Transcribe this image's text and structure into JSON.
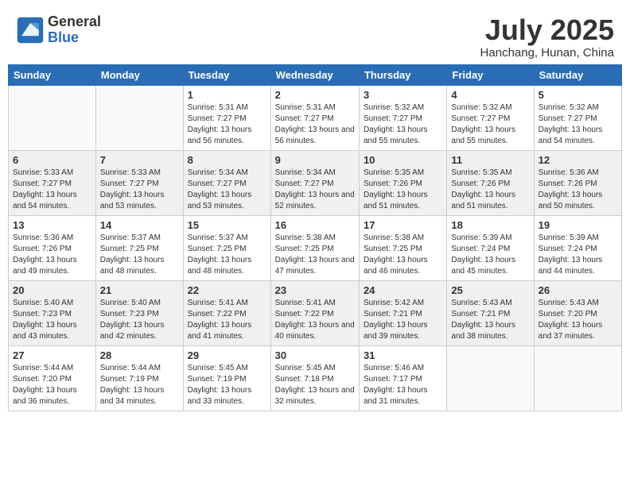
{
  "header": {
    "logo_general": "General",
    "logo_blue": "Blue",
    "month_title": "July 2025",
    "location": "Hanchang, Hunan, China"
  },
  "weekdays": [
    "Sunday",
    "Monday",
    "Tuesday",
    "Wednesday",
    "Thursday",
    "Friday",
    "Saturday"
  ],
  "weeks": [
    [
      {
        "day": "",
        "info": ""
      },
      {
        "day": "",
        "info": ""
      },
      {
        "day": "1",
        "info": "Sunrise: 5:31 AM\nSunset: 7:27 PM\nDaylight: 13 hours and 56 minutes."
      },
      {
        "day": "2",
        "info": "Sunrise: 5:31 AM\nSunset: 7:27 PM\nDaylight: 13 hours and 56 minutes."
      },
      {
        "day": "3",
        "info": "Sunrise: 5:32 AM\nSunset: 7:27 PM\nDaylight: 13 hours and 55 minutes."
      },
      {
        "day": "4",
        "info": "Sunrise: 5:32 AM\nSunset: 7:27 PM\nDaylight: 13 hours and 55 minutes."
      },
      {
        "day": "5",
        "info": "Sunrise: 5:32 AM\nSunset: 7:27 PM\nDaylight: 13 hours and 54 minutes."
      }
    ],
    [
      {
        "day": "6",
        "info": "Sunrise: 5:33 AM\nSunset: 7:27 PM\nDaylight: 13 hours and 54 minutes."
      },
      {
        "day": "7",
        "info": "Sunrise: 5:33 AM\nSunset: 7:27 PM\nDaylight: 13 hours and 53 minutes."
      },
      {
        "day": "8",
        "info": "Sunrise: 5:34 AM\nSunset: 7:27 PM\nDaylight: 13 hours and 53 minutes."
      },
      {
        "day": "9",
        "info": "Sunrise: 5:34 AM\nSunset: 7:27 PM\nDaylight: 13 hours and 52 minutes."
      },
      {
        "day": "10",
        "info": "Sunrise: 5:35 AM\nSunset: 7:26 PM\nDaylight: 13 hours and 51 minutes."
      },
      {
        "day": "11",
        "info": "Sunrise: 5:35 AM\nSunset: 7:26 PM\nDaylight: 13 hours and 51 minutes."
      },
      {
        "day": "12",
        "info": "Sunrise: 5:36 AM\nSunset: 7:26 PM\nDaylight: 13 hours and 50 minutes."
      }
    ],
    [
      {
        "day": "13",
        "info": "Sunrise: 5:36 AM\nSunset: 7:26 PM\nDaylight: 13 hours and 49 minutes."
      },
      {
        "day": "14",
        "info": "Sunrise: 5:37 AM\nSunset: 7:25 PM\nDaylight: 13 hours and 48 minutes."
      },
      {
        "day": "15",
        "info": "Sunrise: 5:37 AM\nSunset: 7:25 PM\nDaylight: 13 hours and 48 minutes."
      },
      {
        "day": "16",
        "info": "Sunrise: 5:38 AM\nSunset: 7:25 PM\nDaylight: 13 hours and 47 minutes."
      },
      {
        "day": "17",
        "info": "Sunrise: 5:38 AM\nSunset: 7:25 PM\nDaylight: 13 hours and 46 minutes."
      },
      {
        "day": "18",
        "info": "Sunrise: 5:39 AM\nSunset: 7:24 PM\nDaylight: 13 hours and 45 minutes."
      },
      {
        "day": "19",
        "info": "Sunrise: 5:39 AM\nSunset: 7:24 PM\nDaylight: 13 hours and 44 minutes."
      }
    ],
    [
      {
        "day": "20",
        "info": "Sunrise: 5:40 AM\nSunset: 7:23 PM\nDaylight: 13 hours and 43 minutes."
      },
      {
        "day": "21",
        "info": "Sunrise: 5:40 AM\nSunset: 7:23 PM\nDaylight: 13 hours and 42 minutes."
      },
      {
        "day": "22",
        "info": "Sunrise: 5:41 AM\nSunset: 7:22 PM\nDaylight: 13 hours and 41 minutes."
      },
      {
        "day": "23",
        "info": "Sunrise: 5:41 AM\nSunset: 7:22 PM\nDaylight: 13 hours and 40 minutes."
      },
      {
        "day": "24",
        "info": "Sunrise: 5:42 AM\nSunset: 7:21 PM\nDaylight: 13 hours and 39 minutes."
      },
      {
        "day": "25",
        "info": "Sunrise: 5:43 AM\nSunset: 7:21 PM\nDaylight: 13 hours and 38 minutes."
      },
      {
        "day": "26",
        "info": "Sunrise: 5:43 AM\nSunset: 7:20 PM\nDaylight: 13 hours and 37 minutes."
      }
    ],
    [
      {
        "day": "27",
        "info": "Sunrise: 5:44 AM\nSunset: 7:20 PM\nDaylight: 13 hours and 36 minutes."
      },
      {
        "day": "28",
        "info": "Sunrise: 5:44 AM\nSunset: 7:19 PM\nDaylight: 13 hours and 34 minutes."
      },
      {
        "day": "29",
        "info": "Sunrise: 5:45 AM\nSunset: 7:19 PM\nDaylight: 13 hours and 33 minutes."
      },
      {
        "day": "30",
        "info": "Sunrise: 5:45 AM\nSunset: 7:18 PM\nDaylight: 13 hours and 32 minutes."
      },
      {
        "day": "31",
        "info": "Sunrise: 5:46 AM\nSunset: 7:17 PM\nDaylight: 13 hours and 31 minutes."
      },
      {
        "day": "",
        "info": ""
      },
      {
        "day": "",
        "info": ""
      }
    ]
  ]
}
